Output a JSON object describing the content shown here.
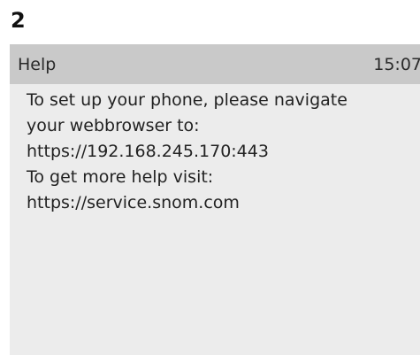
{
  "step_number": "2",
  "screen": {
    "title": "Help",
    "clock": "15:07",
    "lines": [
      "To set up your phone, please navigate",
      "your webbrowser to:",
      "https://192.168.245.170:443",
      "To get more help visit:",
      "https://service.snom.com"
    ]
  },
  "colors": {
    "titlebar_bg": "#c9c9c9",
    "screen_bg": "#ececec",
    "text": "#222222"
  }
}
